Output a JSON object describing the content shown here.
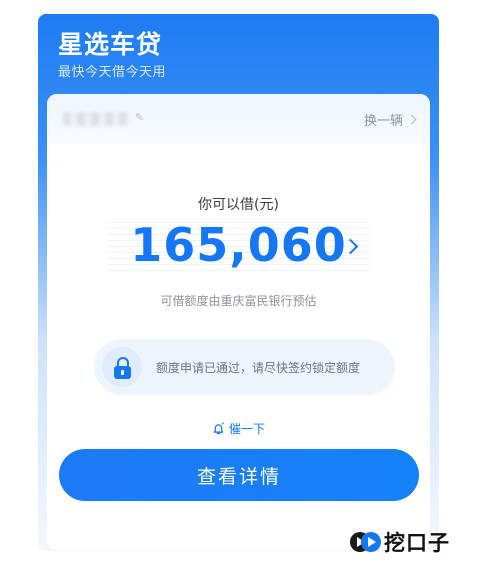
{
  "header": {
    "title": "星选车贷",
    "subtitle": "最快今天借今天用"
  },
  "vehicle": {
    "switch_label": "换一辆"
  },
  "loan": {
    "borrow_label": "你可以借(元)",
    "amount": "165,060",
    "source": "可借额度由重庆富民银行预估"
  },
  "notice": {
    "text": "额度申请已通过，请尽快签约锁定额度",
    "icon": "lock-icon"
  },
  "urge": {
    "label": "催一下",
    "icon": "bell-icon"
  },
  "actions": {
    "detail_label": "查看详情"
  },
  "watermark": {
    "text": "挖口子"
  },
  "colors": {
    "primary": "#1677f5",
    "header_blue": "#1e7cf2"
  }
}
